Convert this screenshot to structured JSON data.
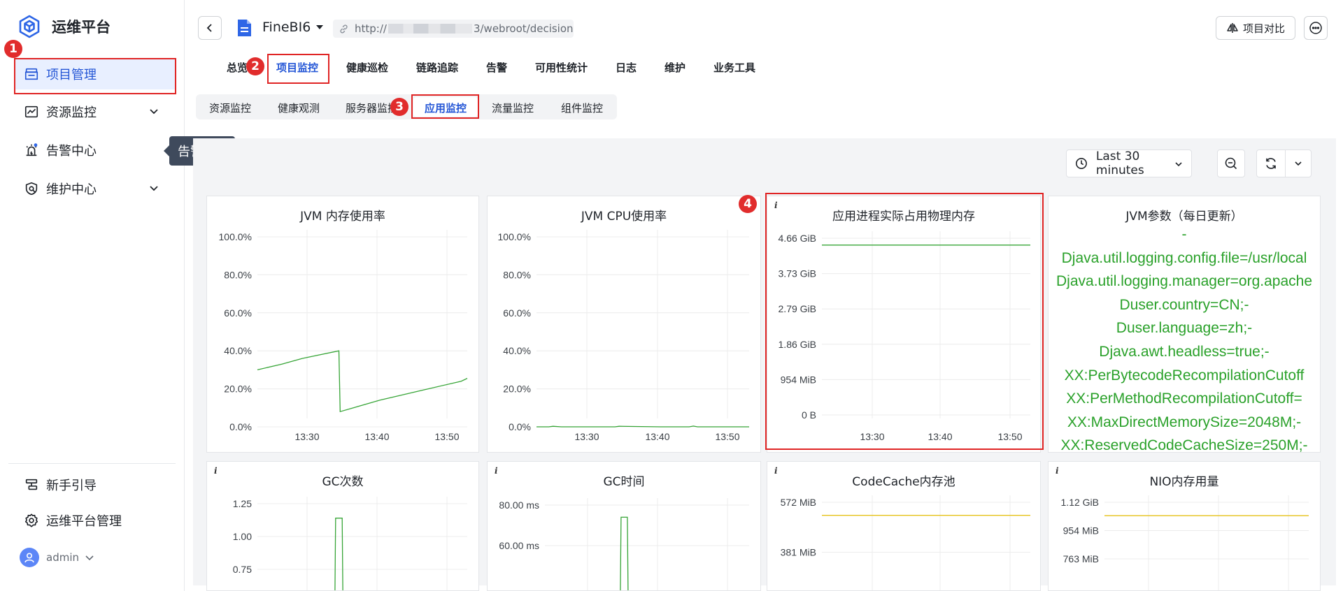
{
  "sidebar": {
    "brand": "运维平台",
    "items": [
      {
        "key": "project",
        "label": "项目管理"
      },
      {
        "key": "resource",
        "label": "资源监控"
      },
      {
        "key": "alarm",
        "label": "告警中心"
      },
      {
        "key": "maint",
        "label": "维护中心"
      }
    ],
    "bottom": [
      {
        "key": "guide",
        "label": "新手引导"
      },
      {
        "key": "platform",
        "label": "运维平台管理"
      }
    ],
    "user": "admin",
    "tooltip": "告警中心"
  },
  "steps": [
    "1",
    "2",
    "3",
    "4"
  ],
  "header": {
    "project_name": "FineBI6",
    "url_prefix": "http://",
    "url_suffix": "3/webroot/decision",
    "compare_label": "项目对比"
  },
  "top_tabs": [
    "总览",
    "项目监控",
    "健康巡检",
    "链路追踪",
    "告警",
    "可用性统计",
    "日志",
    "维护",
    "业务工具"
  ],
  "sub_tabs": [
    "资源监控",
    "健康观测",
    "服务器监控",
    "应用监控",
    "流量监控",
    "组件监控"
  ],
  "time_range": "Last 30 minutes",
  "colors": {
    "accent": "#2456d6",
    "line_green": "#37a537",
    "line_yellow": "#e6c21a",
    "highlight_red": "#e02424"
  },
  "chart_data": [
    {
      "type": "line",
      "title": "JVM 内存使用率",
      "yticks": [
        "100.0%",
        "80.0%",
        "60.0%",
        "40.0%",
        "20.0%",
        "0.0%"
      ],
      "ylim": [
        0,
        100
      ],
      "xticks": [
        "13:30",
        "13:40",
        "13:50"
      ],
      "series": [
        {
          "color": "#37a537",
          "x": [
            0,
            6,
            11,
            20,
            20.3,
            30,
            40,
            50,
            51.5
          ],
          "values": [
            30,
            33,
            36,
            40,
            8,
            14,
            19,
            24,
            25.5
          ]
        }
      ]
    },
    {
      "type": "line",
      "title": "JVM CPU使用率",
      "yticks": [
        "100.0%",
        "80.0%",
        "60.0%",
        "40.0%",
        "20.0%",
        "0.0%"
      ],
      "ylim": [
        0,
        100
      ],
      "xticks": [
        "13:30",
        "13:40",
        "13:50"
      ],
      "series": [
        {
          "color": "#37a537",
          "x": [
            0,
            3,
            4,
            6,
            10,
            19,
            20,
            30,
            37,
            38,
            39,
            40,
            51.5
          ],
          "values": [
            0,
            0,
            0.3,
            0,
            0,
            0,
            0.3,
            0,
            0,
            0.4,
            0,
            0,
            0
          ]
        }
      ]
    },
    {
      "type": "line",
      "title": "应用进程实际占用物理内存",
      "info": "i",
      "yticks": [
        "4.66 GiB",
        "3.73 GiB",
        "2.79 GiB",
        "1.86 GiB",
        "954 MiB",
        "0 B"
      ],
      "ylim": [
        0,
        5
      ],
      "xticks": [
        "13:30",
        "13:40",
        "13:50"
      ],
      "series": [
        {
          "color": "#37a537",
          "x": [
            0,
            51.5
          ],
          "values": [
            4.48,
            4.48
          ]
        }
      ]
    },
    {
      "type": "text",
      "title": "JVM参数（每日更新）",
      "lines": [
        "-",
        "Djava.util.logging.config.file=/usr/local",
        "Djava.util.logging.manager=org.apache",
        "Duser.country=CN;-",
        "Duser.language=zh;-",
        "Djava.awt.headless=true;-",
        "XX:PerBytecodeRecompilationCutoff",
        "XX:PerMethodRecompilationCutoff=",
        "XX:MaxDirectMemorySize=2048M;-",
        "XX:ReservedCodeCacheSize=250M;-"
      ]
    },
    {
      "type": "line",
      "title": "GC次数",
      "info": "i",
      "yticks": [
        "1.25",
        "1.00",
        "0.75"
      ],
      "ylim": [
        0.5,
        1.25
      ],
      "series": [
        {
          "color": "#37a537",
          "x": [
            0,
            19,
            19.2,
            20.8,
            21
          ],
          "values": [
            0,
            0,
            1.14,
            1.14,
            0
          ]
        }
      ]
    },
    {
      "type": "line",
      "title": "GC时间",
      "info": "i",
      "yticks": [
        "80.00 ms",
        "60.00 ms"
      ],
      "ylim": [
        40,
        80
      ],
      "series": [
        {
          "color": "#37a537",
          "x": [
            0,
            19,
            19.2,
            20.8,
            21
          ],
          "values": [
            0,
            0,
            74,
            74,
            0
          ]
        }
      ]
    },
    {
      "type": "line",
      "title": "CodeCache内存池",
      "info": "i",
      "yticks": [
        "572 MiB",
        "381 MiB"
      ],
      "ylim": [
        300,
        572
      ],
      "series": [
        {
          "color": "#e6c21a",
          "x": [
            0,
            51.5
          ],
          "values": [
            522,
            522
          ]
        }
      ]
    },
    {
      "type": "line",
      "title": "NIO内存用量",
      "info": "i",
      "yticks": [
        "1.12 GiB",
        "954 MiB",
        "763 MiB"
      ],
      "ylim": [
        700,
        1147
      ],
      "series": [
        {
          "color": "#e6c21a",
          "x": [
            0,
            51.5
          ],
          "values": [
            1056,
            1056
          ]
        }
      ]
    }
  ]
}
